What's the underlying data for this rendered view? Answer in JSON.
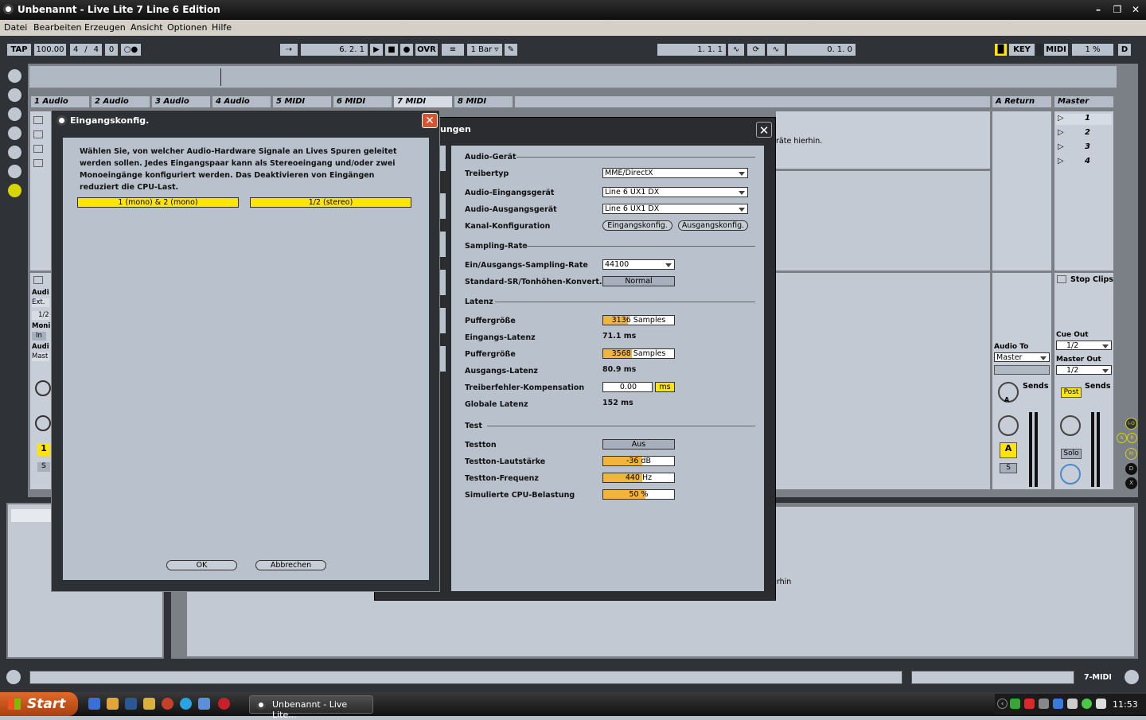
{
  "window": {
    "title": "Unbenannt - Live Lite 7 Line 6 Edition"
  },
  "menu": [
    "Datei",
    "Bearbeiten",
    "Erzeugen",
    "Ansicht",
    "Optionen",
    "Hilfe"
  ],
  "transport": {
    "tap": "TAP",
    "tempo": "100.00",
    "sig_num": "4",
    "sig_sep": "/",
    "sig_den": "4",
    "metro": "0",
    "position": "6.   2.   1",
    "ovr": "OVR",
    "quant": "1 Bar",
    "loop_start": "1.   1.   1",
    "loop_len": "0.   1.   0",
    "key": "KEY",
    "midi": "MIDI",
    "cpu": "1 %",
    "d": "D"
  },
  "tracks": [
    "1 Audio",
    "2 Audio",
    "3 Audio",
    "4 Audio",
    "5 MIDI",
    "6 MIDI",
    "7 MIDI",
    "8 MIDI"
  ],
  "returns": {
    "a_return": "A Return",
    "master": "Master"
  },
  "scenes": [
    "1",
    "2",
    "3",
    "4"
  ],
  "mixer": {
    "stop_clips": "Stop Clips",
    "cue_out": "Cue Out",
    "cue_out_val": "1/2",
    "master_out": "Master Out",
    "master_out_val": "1/2",
    "audio_to": "Audio To",
    "audio_to_val": "Master",
    "sends": "Sends",
    "sends2": "Sends",
    "post": "Post",
    "a_btn": "A",
    "s_btn": "S",
    "solo": "Solo",
    "knob_a": "A",
    "left_audio": "Audi",
    "left_ext": "Ext.",
    "left_12": "1/2",
    "left_moni": "Moni",
    "left_in": "In",
    "left_audio2": "Audi",
    "left_mast": "Mast",
    "left_num": "1",
    "left_s": "S"
  },
  "bg_hint": {
    "drop_text": "räte hierhin.",
    "drop_text2": "erhin"
  },
  "status": {
    "track_name": "7-MIDI"
  },
  "right_icons": [
    "I-O",
    "S",
    "R",
    "M",
    "D",
    "X"
  ],
  "prefs": {
    "title_fragment": "ungen",
    "sec_audio": "Audio-Gerät",
    "driver_label": "Treibertyp",
    "driver_val": "MME/DirectX",
    "in_dev_label": "Audio-Eingangsgerät",
    "in_dev_val": "Line 6 UX1 DX",
    "out_dev_label": "Audio-Ausgangsgerät",
    "out_dev_val": "Line 6 UX1 DX",
    "chan_label": "Kanal-Konfiguration",
    "chan_in_btn": "Eingangskonfig.",
    "chan_out_btn": "Ausgangskonfig.",
    "sec_rate": "Sampling-Rate",
    "rate_label": "Ein/Ausgangs-Sampling-Rate",
    "rate_val": "44100",
    "src_label": "Standard-SR/Tonhöhen-Konvert.",
    "src_val": "Normal",
    "sec_latency": "Latenz",
    "buf1_label": "Puffergröße",
    "buf1_val": "3136 Samples",
    "buf1_fill": 0.35,
    "in_lat_label": "Eingangs-Latenz",
    "in_lat_val": "71.1 ms",
    "buf2_label": "Puffergröße",
    "buf2_val": "3568 Samples",
    "buf2_fill": 0.4,
    "out_lat_label": "Ausgangs-Latenz",
    "out_lat_val": "80.9 ms",
    "comp_label": "Treiberfehler-Kompensation",
    "comp_val": "0.00",
    "comp_unit": "ms",
    "glob_label": "Globale Latenz",
    "glob_val": "152 ms",
    "sec_test": "Test",
    "tone_label": "Testton",
    "tone_val": "Aus",
    "vol_label": "Testton-Lautstärke",
    "vol_val": "-36 dB",
    "vol_fill": 0.55,
    "freq_label": "Testton-Frequenz",
    "freq_val": "440 Hz",
    "freq_fill": 0.55,
    "cpu_label": "Simulierte CPU-Belastung",
    "cpu_val": "50 %",
    "cpu_fill": 0.6
  },
  "input_dialog": {
    "title": "Eingangskonfig.",
    "description": "Wählen Sie, von welcher Audio-Hardware Signale an Lives Spuren geleitet werden sollen. Jedes Eingangspaar kann als Stereoeingang und/oder zwei Monoeingänge konfiguriert werden. Das Deaktivieren von Eingängen reduziert die CPU-Last.",
    "mono_btn": "1 (mono) & 2 (mono)",
    "stereo_btn": "1/2 (stereo)",
    "ok": "OK",
    "cancel": "Abbrechen"
  },
  "taskbar": {
    "start": "Start",
    "task": "Unbenannt - Live Lite...",
    "clock": "11:53"
  },
  "colors": {
    "accent_yellow": "#ffe500",
    "orange_fill": "#f2b53c",
    "panel": "#b9c1cc"
  }
}
